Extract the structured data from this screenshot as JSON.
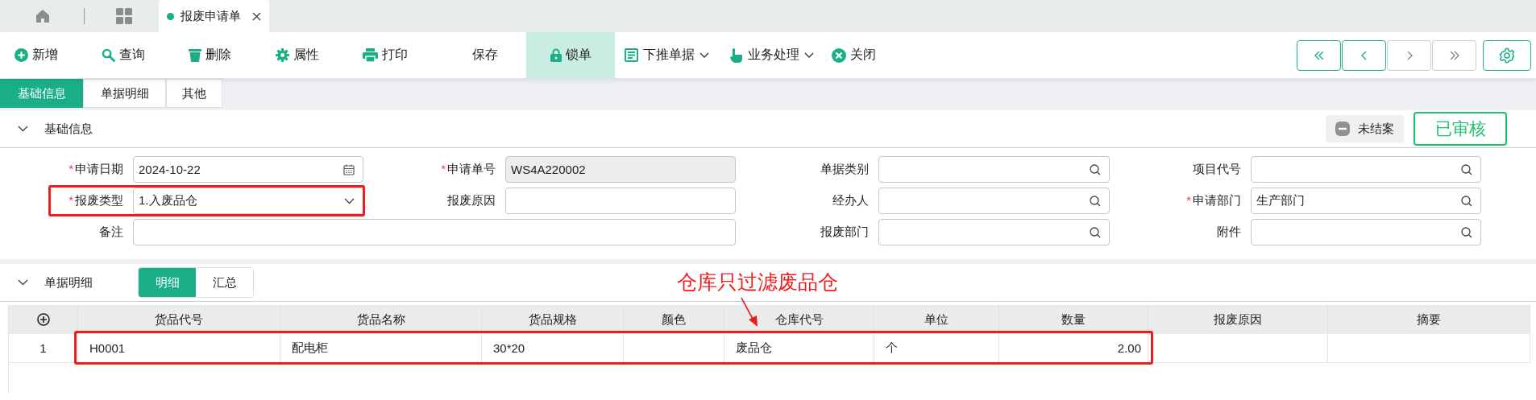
{
  "doc_tabs": [
    {
      "kind": "home",
      "selected": false
    },
    {
      "kind": "apps",
      "selected": false
    },
    {
      "kind": "doc",
      "label": "报废申请单",
      "selected": true
    }
  ],
  "toolbar": {
    "buttons": [
      {
        "label": "新增",
        "selected": false,
        "dropdown": false
      },
      {
        "label": "查询",
        "selected": false,
        "dropdown": false
      },
      {
        "label": "删除",
        "selected": false,
        "dropdown": false
      },
      {
        "label": "属性",
        "selected": false,
        "dropdown": false
      },
      {
        "label": "打印",
        "selected": false,
        "dropdown": false
      },
      {
        "label": "保存",
        "selected": false,
        "dropdown": false
      },
      {
        "label": "锁单",
        "selected": true,
        "dropdown": false
      },
      {
        "label": "下推单据",
        "selected": false,
        "dropdown": true
      },
      {
        "label": "业务处理",
        "selected": false,
        "dropdown": true
      },
      {
        "label": "关闭",
        "selected": false,
        "dropdown": false
      }
    ],
    "nav_buttons": [
      {
        "disabled": false
      },
      {
        "disabled": false
      },
      {
        "disabled": true
      },
      {
        "disabled": true
      }
    ]
  },
  "section_tabs": [
    {
      "label": "基础信息",
      "selected": true
    },
    {
      "label": "单据明细",
      "selected": false
    },
    {
      "label": "其他",
      "selected": false
    }
  ],
  "basic": {
    "title": "基础信息",
    "expanded": true,
    "close_status": "未结案",
    "audit_status": "已审核",
    "fields": [
      {
        "required_mark": "*",
        "label": "申请日期",
        "kind": "date",
        "value": "2024-10-22"
      },
      {
        "required_mark": "*",
        "label": "申请单号",
        "kind": "readonly",
        "value": "WS4A220002"
      },
      {
        "label": "单据类别",
        "kind": "lookup"
      },
      {
        "label": "项目代号",
        "kind": "lookup"
      },
      {
        "required_mark": "*",
        "label": "报废类型",
        "kind": "select",
        "value": "1.入废品仓",
        "highlighted": true
      },
      {
        "label": "报废原因",
        "kind": "text"
      },
      {
        "label": "经办人",
        "kind": "lookup"
      },
      {
        "required_mark": "*",
        "label": "申请部门",
        "kind": "lookup",
        "value": "生产部门"
      },
      {
        "label": "备注",
        "kind": "memo"
      },
      {
        "label": "报废部门",
        "kind": "lookup"
      },
      {
        "label": "附件",
        "kind": "lookup"
      }
    ]
  },
  "detail": {
    "title": "单据明细",
    "expanded": true,
    "views": [
      {
        "label": "明细",
        "selected": true
      },
      {
        "label": "汇总",
        "selected": false
      }
    ],
    "annotation": "仓库只过滤废品仓",
    "table": {
      "columns": [
        "货品代号",
        "货品名称",
        "货品规格",
        "颜色",
        "仓库代号",
        "单位",
        "数量",
        "报废原因",
        "摘要"
      ],
      "rows": [
        {
          "index": "1",
          "highlighted": true,
          "cells": [
            "H0001",
            "配电柜",
            "30*20",
            "",
            "废品仓",
            "个",
            "2.00",
            "",
            ""
          ]
        }
      ]
    }
  }
}
